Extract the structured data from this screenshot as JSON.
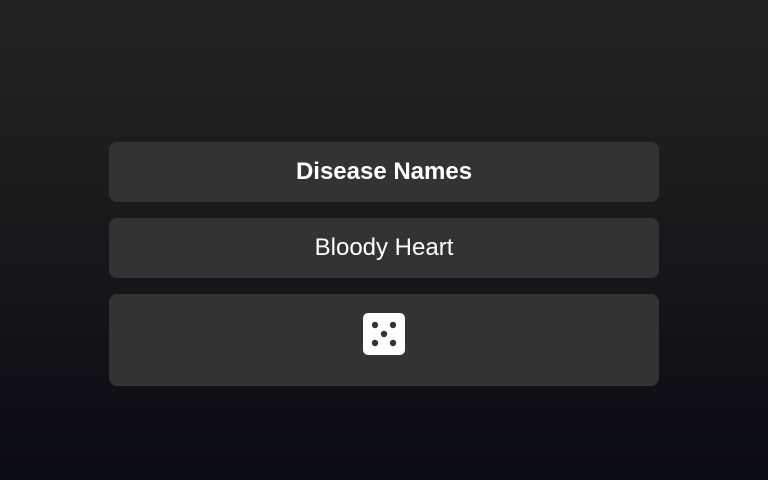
{
  "app": {
    "title": "Disease Names"
  },
  "generator": {
    "result": "Bloody Heart"
  },
  "roll_button": {
    "icon": "dice-five-icon",
    "colors": {
      "die_face": "#ffffff",
      "die_pips": "#333333"
    }
  },
  "colors": {
    "panel": "#333333",
    "text": "#ffffff",
    "background_top": "#232323",
    "background_bottom": "#0a0b14"
  }
}
